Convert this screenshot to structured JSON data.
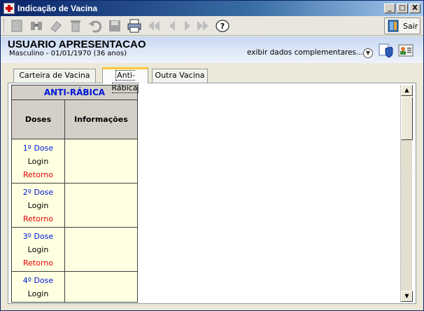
{
  "window": {
    "title": "Indicação de Vacina",
    "controls": {
      "minimize": "_",
      "maximize": "□",
      "close": "X"
    }
  },
  "toolbar": {
    "icons": [
      "new-icon",
      "search-icon",
      "erase-icon",
      "delete-icon",
      "undo-icon",
      "save-icon",
      "print-icon",
      "first-icon",
      "prev-icon",
      "next-icon",
      "last-icon",
      "help-icon"
    ],
    "help_label": "?",
    "exit_label": "Sair"
  },
  "patient": {
    "name": "USUARIO APRESENTACAO",
    "details": "Masculino - 01/01/1970 (36 anos)",
    "complement_link": "exibir dados complementares..."
  },
  "tabs": [
    {
      "label": "Carteira de Vacina",
      "active": false
    },
    {
      "label": "Anti-Rábica",
      "active": true
    },
    {
      "label": "Outra Vacina",
      "active": false
    }
  ],
  "vaccine_table": {
    "title": "ANTI-RÁBICA",
    "col_doses": "Doses",
    "col_info": "Informações",
    "rows": [
      {
        "dose": "1º Dose",
        "login": "Login",
        "retorno": "Retorno"
      },
      {
        "dose": "2º Dose",
        "login": "Login",
        "retorno": "Retorno"
      },
      {
        "dose": "3º Dose",
        "login": "Login",
        "retorno": "Retorno"
      },
      {
        "dose": "4º Dose",
        "login": "Login",
        "retorno": ""
      }
    ]
  },
  "colors": {
    "accent_blue": "#0018d8",
    "retorno_red": "#e00000",
    "cell_yellow": "#ffffe1"
  }
}
